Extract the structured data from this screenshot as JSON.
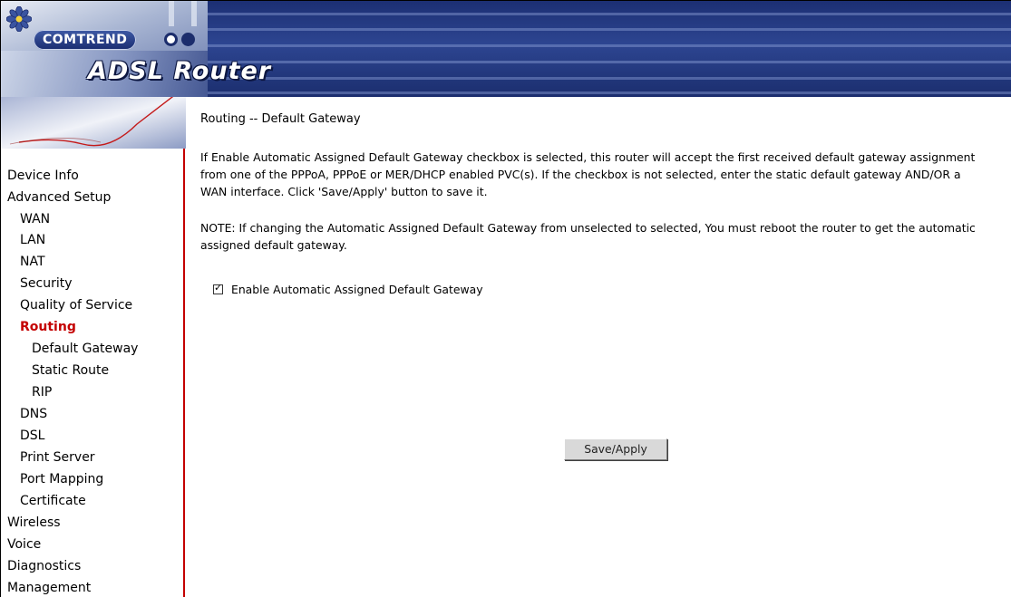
{
  "header": {
    "brand": "COMTREND",
    "product": "ADSL Router"
  },
  "nav": {
    "items": [
      {
        "label": "Device Info",
        "level": 0
      },
      {
        "label": "Advanced Setup",
        "level": 0
      },
      {
        "label": "WAN",
        "level": 1
      },
      {
        "label": "LAN",
        "level": 1
      },
      {
        "label": "NAT",
        "level": 1
      },
      {
        "label": "Security",
        "level": 1
      },
      {
        "label": "Quality of Service",
        "level": 1
      },
      {
        "label": "Routing",
        "level": 1,
        "active": true
      },
      {
        "label": "Default Gateway",
        "level": 2
      },
      {
        "label": "Static Route",
        "level": 2
      },
      {
        "label": "RIP",
        "level": 2
      },
      {
        "label": "DNS",
        "level": 1
      },
      {
        "label": "DSL",
        "level": 1
      },
      {
        "label": "Print Server",
        "level": 1
      },
      {
        "label": "Port Mapping",
        "level": 1
      },
      {
        "label": "Certificate",
        "level": 1
      },
      {
        "label": "Wireless",
        "level": 0
      },
      {
        "label": "Voice",
        "level": 0
      },
      {
        "label": "Diagnostics",
        "level": 0
      },
      {
        "label": "Management",
        "level": 0
      }
    ]
  },
  "main": {
    "title": "Routing -- Default Gateway",
    "description": "If Enable Automatic Assigned Default Gateway checkbox is selected, this router will accept the first received default gateway assignment from one of the PPPoA, PPPoE or MER/DHCP enabled PVC(s). If the checkbox is not selected, enter the static default gateway AND/OR a WAN interface. Click 'Save/Apply' button to save it.",
    "note": "NOTE: If changing the Automatic Assigned Default Gateway from unselected to selected, You must reboot the router to get the automatic assigned default gateway.",
    "checkbox_label": "Enable Automatic Assigned Default Gateway",
    "checkbox_checked": true,
    "save_button": "Save/Apply"
  },
  "colors": {
    "active_nav": "#c40000",
    "header_blue": "#1c2f73",
    "nav_border": "#c40000"
  }
}
